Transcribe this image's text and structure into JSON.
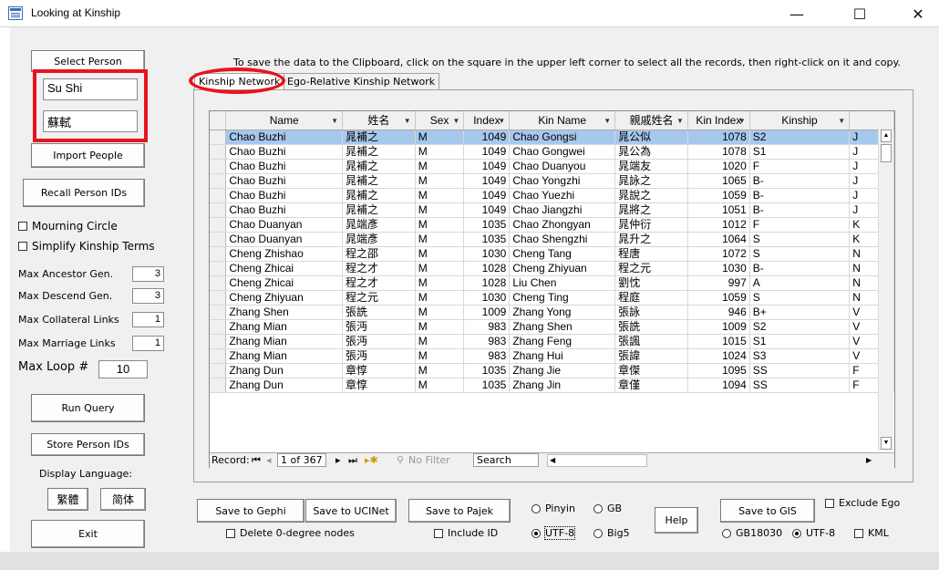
{
  "window": {
    "title": "Looking at Kinship",
    "minimize_glyph": "—",
    "maximize_glyph": "☐",
    "close_glyph": "✕"
  },
  "left": {
    "select_person_label": "Select Person",
    "person_name_en": "Su Shi",
    "person_name_zh": "蘇軾",
    "import_people_label": "Import People",
    "recall_ids_label": "Recall Person IDs",
    "mourning_circle_label": "Mourning Circle",
    "simplify_terms_label": "Simplify Kinship Terms",
    "params": [
      {
        "label": "Max Ancestor Gen.",
        "value": "3"
      },
      {
        "label": "Max Descend Gen.",
        "value": "3"
      },
      {
        "label": "Max Collateral Links",
        "value": "1"
      },
      {
        "label": "Max Marriage Links",
        "value": "1"
      }
    ],
    "max_loop_label": "Max Loop #",
    "max_loop_value": "10",
    "run_query_label": "Run Query",
    "store_ids_label": "Store Person IDs",
    "display_language_label": "Display Language:",
    "lang_trad_label": "繁體",
    "lang_simp_label": "简体",
    "exit_label": "Exit"
  },
  "instructions": "To save the data to the Clipboard, click on the square in the upper left corner to select all the records, then right-click on it and copy.",
  "tabs": [
    {
      "label": "Kinship Network",
      "active": true
    },
    {
      "label": "Ego-Relative Kinship Network",
      "active": false
    }
  ],
  "grid": {
    "columns": [
      "Name",
      "姓名",
      "Sex",
      "Index",
      "Kin Name",
      "親戚姓名",
      "Kin Index",
      "Kinship"
    ],
    "rows": [
      [
        "Chao Buzhi",
        "晁補之",
        "M",
        "1049",
        "Chao Gongsi",
        "晁公似",
        "1078",
        "S2",
        "J"
      ],
      [
        "Chao Buzhi",
        "晁補之",
        "M",
        "1049",
        "Chao Gongwei",
        "晁公為",
        "1078",
        "S1",
        "J"
      ],
      [
        "Chao Buzhi",
        "晁補之",
        "M",
        "1049",
        "Chao Duanyou",
        "晁端友",
        "1020",
        "F",
        "J"
      ],
      [
        "Chao Buzhi",
        "晁補之",
        "M",
        "1049",
        "Chao Yongzhi",
        "晁詠之",
        "1065",
        "B-",
        "J"
      ],
      [
        "Chao Buzhi",
        "晁補之",
        "M",
        "1049",
        "Chao Yuezhi",
        "晁說之",
        "1059",
        "B-",
        "J"
      ],
      [
        "Chao Buzhi",
        "晁補之",
        "M",
        "1049",
        "Chao Jiangzhi",
        "晁將之",
        "1051",
        "B-",
        "J"
      ],
      [
        "Chao Duanyan",
        "晁端彥",
        "M",
        "1035",
        "Chao Zhongyan",
        "晁仲衍",
        "1012",
        "F",
        "K"
      ],
      [
        "Chao Duanyan",
        "晁端彥",
        "M",
        "1035",
        "Chao Shengzhi",
        "晁升之",
        "1064",
        "S",
        "K"
      ],
      [
        "Cheng Zhishao",
        "程之邵",
        "M",
        "1030",
        "Cheng Tang",
        "程唐",
        "1072",
        "S",
        "N"
      ],
      [
        "Cheng Zhicai",
        "程之才",
        "M",
        "1028",
        "Cheng Zhiyuan",
        "程之元",
        "1030",
        "B-",
        "N"
      ],
      [
        "Cheng Zhicai",
        "程之才",
        "M",
        "1028",
        "Liu Chen",
        "劉忱",
        "997",
        "A",
        "N"
      ],
      [
        "Cheng Zhiyuan",
        "程之元",
        "M",
        "1030",
        "Cheng Ting",
        "程庭",
        "1059",
        "S",
        "N"
      ],
      [
        "Zhang Shen",
        "張詵",
        "M",
        "1009",
        "Zhang Yong",
        "張詠",
        "946",
        "B+",
        "V"
      ],
      [
        "Zhang Mian",
        "張沔",
        "M",
        "983",
        "Zhang Shen",
        "張詵",
        "1009",
        "S2",
        "V"
      ],
      [
        "Zhang Mian",
        "張沔",
        "M",
        "983",
        "Zhang Feng",
        "張諷",
        "1015",
        "S1",
        "V"
      ],
      [
        "Zhang Mian",
        "張沔",
        "M",
        "983",
        "Zhang Hui",
        "張諱",
        "1024",
        "S3",
        "V"
      ],
      [
        "Zhang Dun",
        "章惇",
        "M",
        "1035",
        "Zhang Jie",
        "章傑",
        "1095",
        "SS",
        "F"
      ],
      [
        "Zhang Dun",
        "章惇",
        "M",
        "1035",
        "Zhang Jin",
        "章僅",
        "1094",
        "SS",
        "F"
      ]
    ]
  },
  "navbar": {
    "record_label": "Record:",
    "position": "1 of 367",
    "no_filter_label": "No Filter",
    "search_label": "Search"
  },
  "bottom": {
    "gephi_label": "Save to Gephi",
    "ucinet_label": "Save to UCINet",
    "pajek_label": "Save to Pajek",
    "delete_zero_label": "Delete 0-degree nodes",
    "include_id_label": "Include ID",
    "pinyin_label": "Pinyin",
    "gb_label": "GB",
    "utf8_label": "UTF-8",
    "big5_label": "Big5",
    "help_label": "Help",
    "gis_label": "Save to GIS",
    "exclude_ego_label": "Exclude Ego",
    "gb18030_label": "GB18030",
    "gis_utf8_label": "UTF-8",
    "kml_label": "KML"
  }
}
